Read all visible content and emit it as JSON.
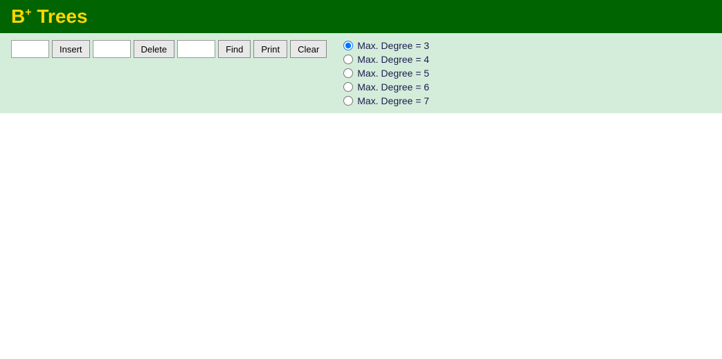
{
  "header": {
    "title_base": "B",
    "title_sup": "+",
    "title_suffix": " Trees"
  },
  "toolbar": {
    "insert_input_value": "",
    "insert_label": "Insert",
    "delete_input_value": "",
    "delete_label": "Delete",
    "find_input_value": "",
    "find_label": "Find",
    "print_label": "Print",
    "clear_label": "Clear"
  },
  "radio_group": {
    "options": [
      {
        "label": "Max. Degree = 3",
        "value": "3",
        "checked": true
      },
      {
        "label": "Max. Degree = 4",
        "value": "4",
        "checked": false
      },
      {
        "label": "Max. Degree = 5",
        "value": "5",
        "checked": false
      },
      {
        "label": "Max. Degree = 6",
        "value": "6",
        "checked": false
      },
      {
        "label": "Max. Degree = 7",
        "value": "7",
        "checked": false
      }
    ]
  }
}
